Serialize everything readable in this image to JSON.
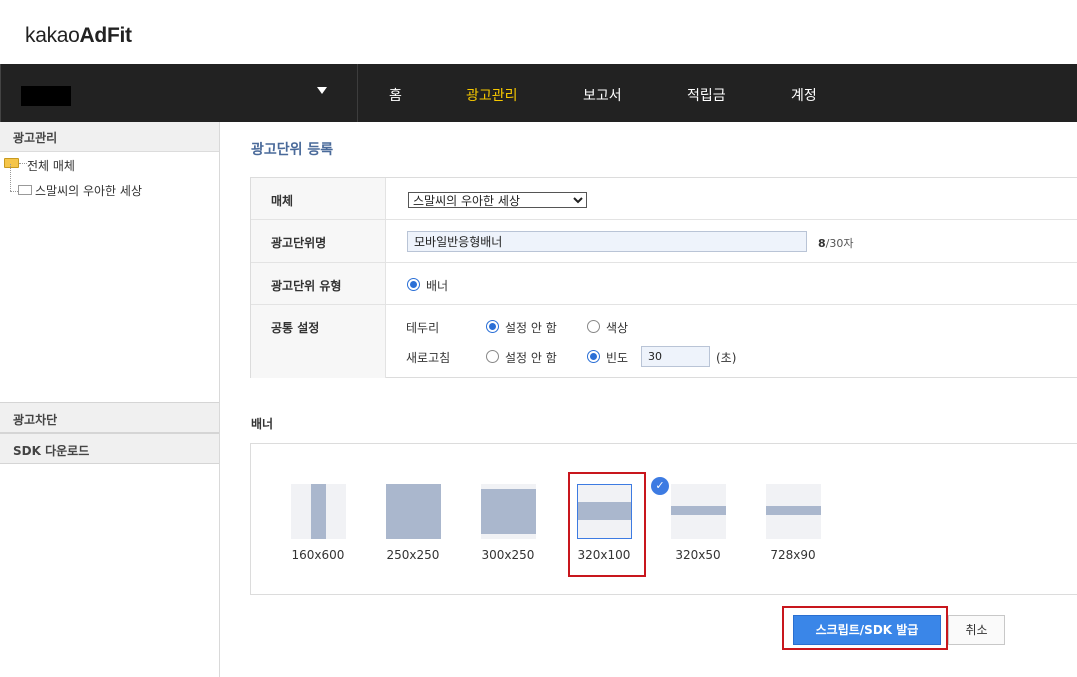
{
  "logo": {
    "prefix": "kakao",
    "bold": "AdFit"
  },
  "nav": {
    "items": [
      {
        "label": "홈",
        "active": false
      },
      {
        "label": "광고관리",
        "active": true
      },
      {
        "label": "보고서",
        "active": false
      },
      {
        "label": "적립금",
        "active": false
      },
      {
        "label": "계정",
        "active": false
      }
    ],
    "active_color": "#f6c800"
  },
  "sidebar": {
    "header": "광고관리",
    "tree": [
      {
        "label": "전체 매체",
        "icon": "folder-open-icon"
      },
      {
        "label": "스말씨의 우아한 세상",
        "icon": "folder-icon"
      }
    ],
    "sections": [
      "광고차단",
      "SDK 다운로드"
    ]
  },
  "main": {
    "title": "광고단위 등록",
    "form": {
      "media_label": "매체",
      "media_value": "스말씨의 우아한 세상",
      "unit_name_label": "광고단위명",
      "unit_name_value": "모바일반응형배너",
      "unit_name_count": "8",
      "unit_name_max": "/30자",
      "type_label": "광고단위 유형",
      "type_option": "배너",
      "common_label": "공통 설정",
      "border_label": "테두리",
      "border_opt_none": "설정 안 함",
      "border_opt_color": "색상",
      "refresh_label": "새로고침",
      "refresh_opt_none": "설정 안 함",
      "refresh_opt_freq": "빈도",
      "refresh_value": "30",
      "refresh_unit": "(초)"
    },
    "banner": {
      "title": "배너",
      "sizes": [
        "160x600",
        "250x250",
        "300x250",
        "320x100",
        "320x50",
        "728x90"
      ],
      "selected": "320x100"
    },
    "buttons": {
      "issue": "스크립트/SDK 발급",
      "cancel": "취소"
    }
  },
  "colors": {
    "brand_blue": "#3a86e8",
    "highlight_red": "#c8161d",
    "thumb_fill": "#aab7cd"
  }
}
